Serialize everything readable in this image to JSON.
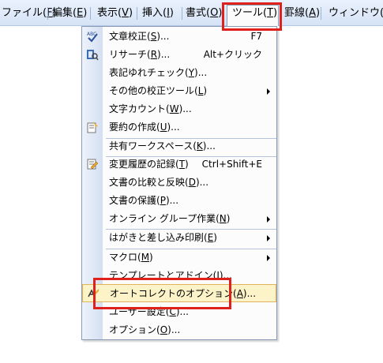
{
  "menubar": {
    "items": [
      {
        "label": "ファイル(",
        "key": "F",
        "tail": ")"
      },
      {
        "label": "編集(",
        "key": "E",
        "tail": ")"
      },
      {
        "label": "表示(",
        "key": "V",
        "tail": ")"
      },
      {
        "label": "挿入(",
        "key": "I",
        "tail": ")"
      },
      {
        "label": "書式(",
        "key": "O",
        "tail": ")"
      },
      {
        "label": "ツール(",
        "key": "T",
        "tail": ")"
      },
      {
        "label": "罫線(",
        "key": "A",
        "tail": ")"
      },
      {
        "label": "ウィンドウ(",
        "key": "W",
        "tail": ")"
      }
    ]
  },
  "menu": {
    "items": [
      {
        "label": "文章校正(",
        "key": "S",
        "tail": ")...",
        "shortcut": "F7",
        "icon": "abc-check-icon"
      },
      {
        "label": "リサーチ(",
        "key": "R",
        "tail": ")...",
        "shortcut": "Alt+クリック",
        "icon": "research-book-icon"
      },
      {
        "label": "表記ゆれチェック(",
        "key": "Y",
        "tail": ")..."
      },
      {
        "label": "その他の校正ツール(",
        "key": "L",
        "tail": ")"
      },
      {
        "label": "文字カウント(",
        "key": "W",
        "tail": ")..."
      },
      {
        "label": "要約の作成(",
        "key": "U",
        "tail": ")...",
        "icon": "summary-icon"
      },
      {
        "label": "共有ワークスペース(",
        "key": "K",
        "tail": ")..."
      },
      {
        "label": "変更履歴の記録(",
        "key": "T",
        "tail": ")",
        "shortcut": "Ctrl+Shift+E",
        "icon": "track-changes-icon"
      },
      {
        "label": "文書の比較と反映(",
        "key": "D",
        "tail": ")..."
      },
      {
        "label": "文書の保護(",
        "key": "P",
        "tail": ")..."
      },
      {
        "label": "オンライン グループ作業(",
        "key": "N",
        "tail": ")"
      },
      {
        "label": "はがきと差し込み印刷(",
        "key": "E",
        "tail": ")"
      },
      {
        "label": "マクロ(",
        "key": "M",
        "tail": ")"
      },
      {
        "label": "テンプレートとアドイン(",
        "key": "I",
        "tail": ")..."
      },
      {
        "label": "オートコレクトのオプション(",
        "key": "A",
        "tail": ")...",
        "icon": "autocorrect-icon"
      },
      {
        "label": "ユーザー設定(",
        "key": "C",
        "tail": ")..."
      },
      {
        "label": "オプション(",
        "key": "O",
        "tail": ")..."
      }
    ]
  },
  "colors": {
    "highlight_box": "#e0201b",
    "menu_highlight": "#fdf3c8"
  }
}
